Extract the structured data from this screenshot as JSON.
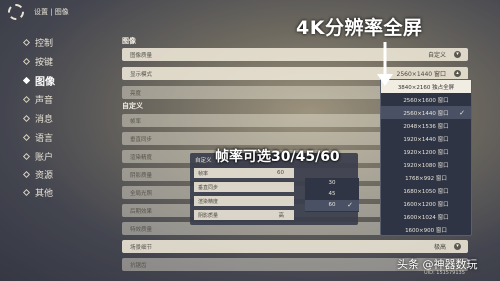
{
  "breadcrumb": "设置 | 图像",
  "sidebar": {
    "items": [
      {
        "label": "控制"
      },
      {
        "label": "按键"
      },
      {
        "label": "图像"
      },
      {
        "label": "声音"
      },
      {
        "label": "消息"
      },
      {
        "label": "语言"
      },
      {
        "label": "账户"
      },
      {
        "label": "资源"
      },
      {
        "label": "其他"
      }
    ]
  },
  "graphics": {
    "section_title": "图像",
    "quality_label": "图像质量",
    "quality_value": "自定义",
    "display_label": "显示模式",
    "display_value": "2560×1440 窗口",
    "brightness_label": "亮度"
  },
  "custom": {
    "section_title": "自定义",
    "rows": [
      {
        "label": "帧率"
      },
      {
        "label": "垂直同步"
      },
      {
        "label": "渲染精度"
      },
      {
        "label": "阴影质量"
      },
      {
        "label": "全局光照"
      },
      {
        "label": "后期效果"
      },
      {
        "label": "特效质量"
      },
      {
        "label": "场景细节"
      },
      {
        "label": "抗锯齿"
      }
    ],
    "scene_detail_value": "极高"
  },
  "resolution_dropdown": {
    "items": [
      "3840×2160 独占全屏",
      "2560×1600 窗口",
      "2560×1440 窗口",
      "2048×1536 窗口",
      "1920×1440 窗口",
      "1920×1200 窗口",
      "1920×1080 窗口",
      "1768×992 窗口",
      "1680×1050 窗口",
      "1600×1200 窗口",
      "1600×1024 窗口",
      "1600×900 窗口"
    ]
  },
  "fps_panel": {
    "title": "自定义",
    "rows": [
      {
        "label": "帧率",
        "value": "60"
      },
      {
        "label": "垂直同步",
        "value": ""
      },
      {
        "label": "渲染精度",
        "value": ""
      },
      {
        "label": "阴影质量",
        "value": "高"
      }
    ],
    "options": [
      "30",
      "45",
      "60"
    ]
  },
  "annotations": {
    "headline": "4K分辨率全屏",
    "fps_caption": "帧率可选30/45/60"
  },
  "uid": "UID: 151579135",
  "watermark": "头条 @神器数玩"
}
